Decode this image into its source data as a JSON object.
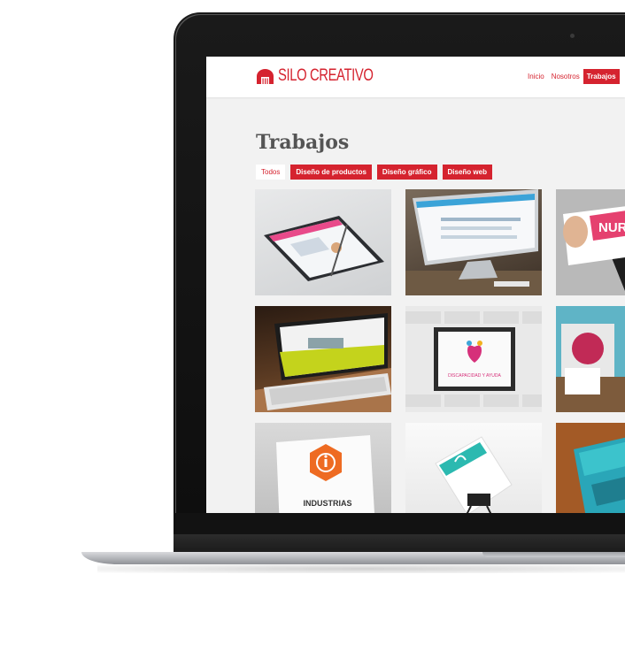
{
  "site": {
    "logo_text": "SILO CREATIVO",
    "brand_color": "#d5232f"
  },
  "nav": {
    "items": [
      {
        "label": "Inicio",
        "active": false
      },
      {
        "label": "Nosotros",
        "active": false
      },
      {
        "label": "Trabajos",
        "active": true
      }
    ]
  },
  "page": {
    "title": "Trabajos"
  },
  "filters": [
    {
      "label": "Todos",
      "selected": true
    },
    {
      "label": "Diseño de productos",
      "selected": false
    },
    {
      "label": "Diseño gráfico",
      "selected": false
    },
    {
      "label": "Diseño web",
      "selected": false
    }
  ],
  "portfolio": {
    "items": [
      {
        "kind": "tablet-web-mockup"
      },
      {
        "kind": "monitor-dashboard-mockup"
      },
      {
        "kind": "business-card-mockup",
        "text": "NUR"
      },
      {
        "kind": "tablet-keyboard-mockup"
      },
      {
        "kind": "framed-logo-mockup",
        "text": "DISCAPACIDAD Y AYUDA"
      },
      {
        "kind": "stationery-mockup"
      },
      {
        "kind": "sign-logo-mockup",
        "text": "INDUSTRIAS"
      },
      {
        "kind": "card-clip-mockup"
      },
      {
        "kind": "brochure-mockup"
      }
    ]
  }
}
